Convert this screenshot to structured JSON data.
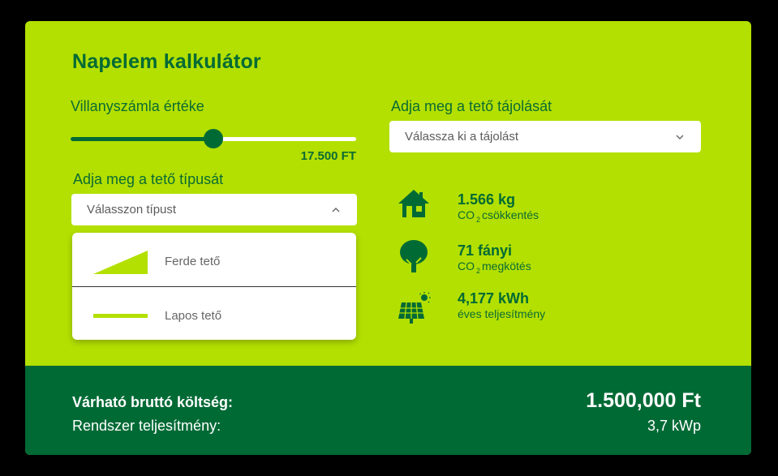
{
  "title": "Napelem kalkulátor",
  "bill": {
    "label": "Villanyszámla értéke",
    "value_text": "17.500 FT",
    "slider_fraction": 0.5
  },
  "roof_type": {
    "label": "Adja meg a tető típusát",
    "placeholder": "Válasszon típust",
    "options": [
      {
        "label": "Ferde tető",
        "icon": "sloped-roof-icon"
      },
      {
        "label": "Lapos tető",
        "icon": "flat-roof-icon"
      }
    ]
  },
  "orientation": {
    "label": "Adja meg a tető tájolását",
    "placeholder": "Válassza ki a tájolást"
  },
  "stats": [
    {
      "icon": "house-icon",
      "value": "1.566 kg",
      "label_pre": "CO",
      "label_sub": "2",
      "label_post": "csökkentés"
    },
    {
      "icon": "tree-icon",
      "value": "71 fányi",
      "label_pre": "CO",
      "label_sub": "2",
      "label_post": "megkötés"
    },
    {
      "icon": "solar-panel-icon",
      "value": "4,177 kWh",
      "label_pre": "éves teljesítmény",
      "label_sub": "",
      "label_post": ""
    }
  ],
  "footer": {
    "cost_label": "Várható bruttó költség:",
    "cost_value": "1.500,000 Ft",
    "power_label": "Rendszer teljesítmény:",
    "power_value": "3,7 kWp"
  },
  "colors": {
    "background": "#b3e000",
    "accent_dark_green": "#006a35",
    "black_frame": "#000000"
  }
}
